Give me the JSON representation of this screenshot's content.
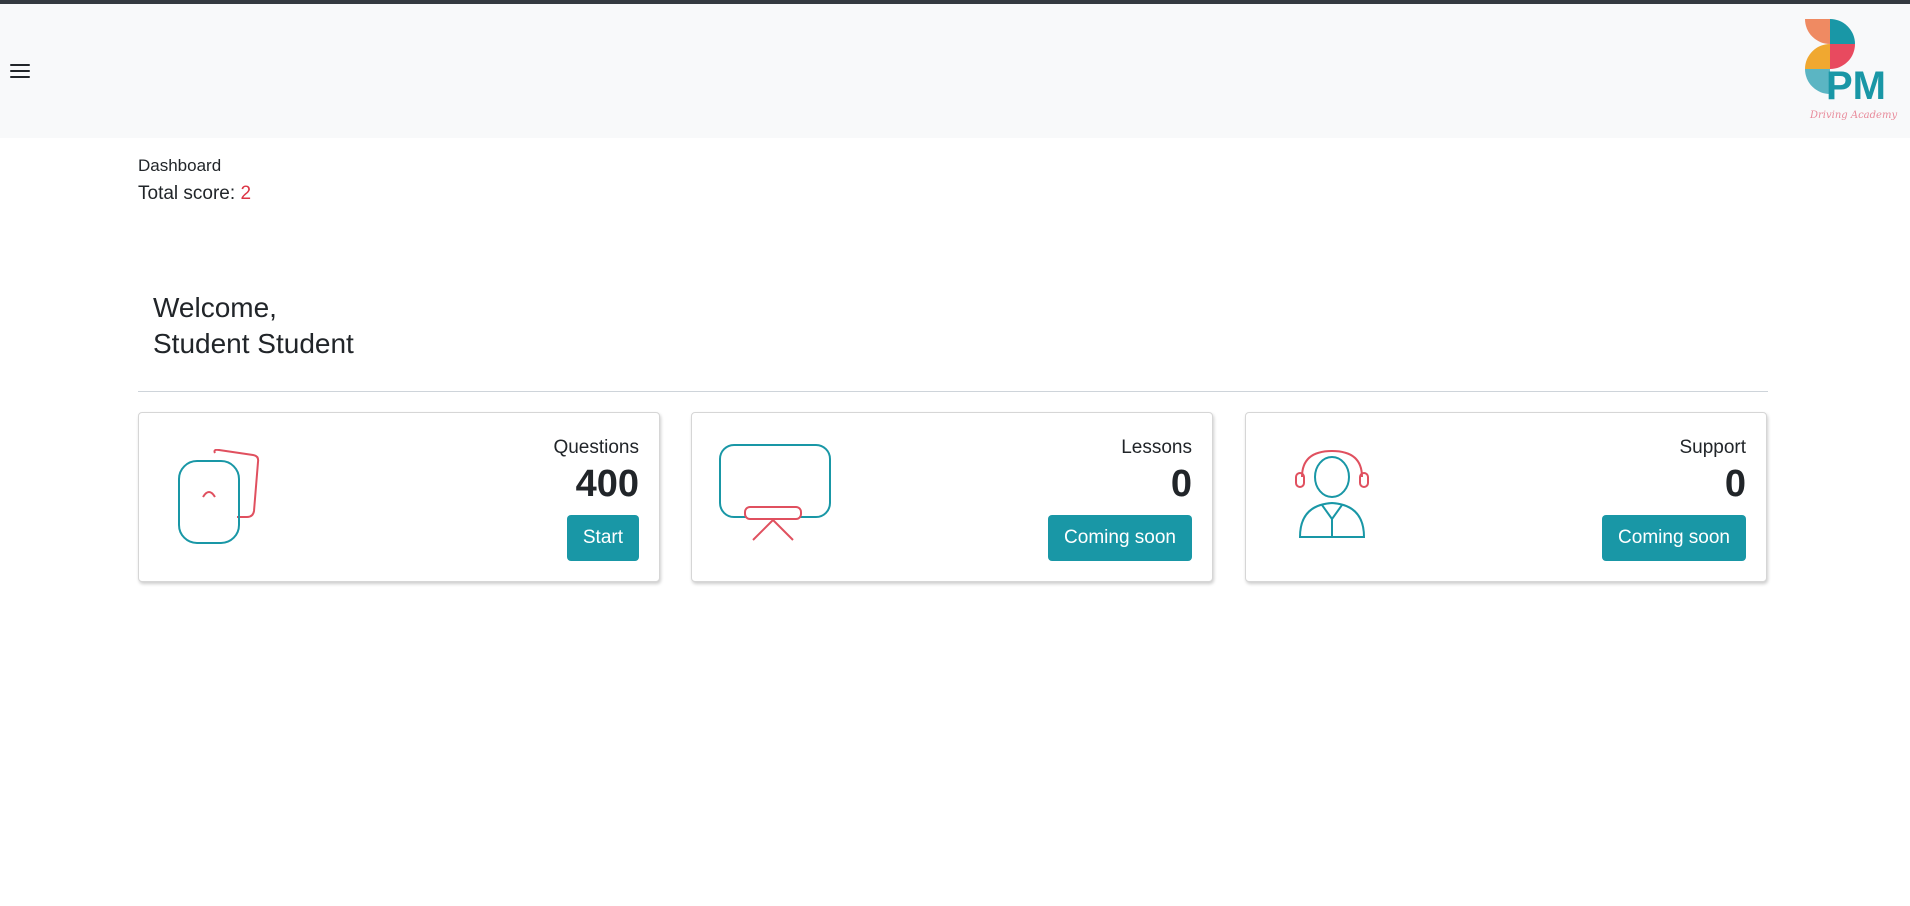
{
  "header": {
    "menu_icon": "hamburger-menu-icon",
    "logo_text": "PM",
    "logo_tagline": "Driving Academy"
  },
  "breadcrumb": "Dashboard",
  "score": {
    "label": "Total score: ",
    "value": "2"
  },
  "welcome": {
    "line1": "Welcome,",
    "line2": "Student Student"
  },
  "cards": [
    {
      "title": "Questions",
      "count": "400",
      "button": "Start",
      "icon": "question-cards-icon"
    },
    {
      "title": "Lessons",
      "count": "0",
      "button": "Coming soon",
      "icon": "whiteboard-icon"
    },
    {
      "title": "Support",
      "count": "0",
      "button": "Coming soon",
      "icon": "headset-support-icon"
    }
  ],
  "colors": {
    "accent": "#1997a6",
    "red": "#dc3545",
    "header_bg": "#f8f9fa"
  }
}
